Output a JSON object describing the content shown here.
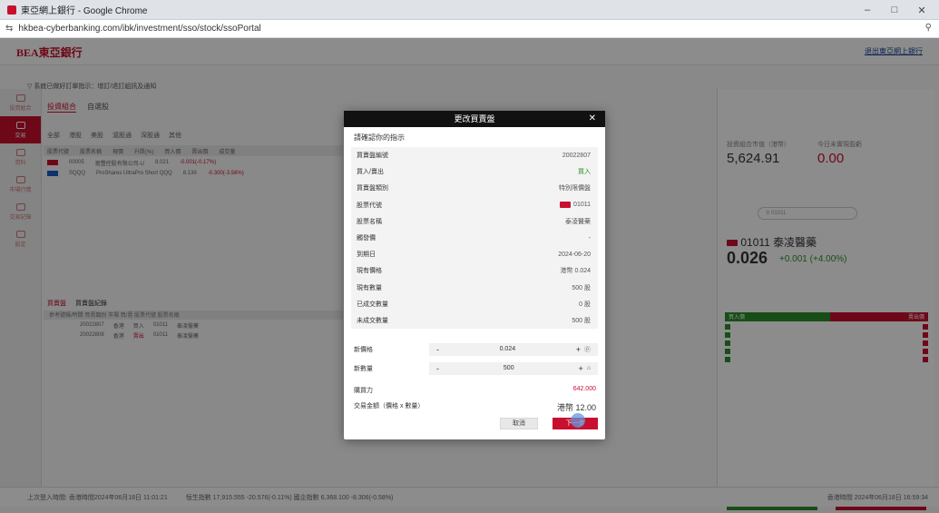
{
  "browser": {
    "window_title": "東亞網上銀行 - Google Chrome",
    "url": "hkbea-cyberbanking.com/ibk/investment/sso/stock/ssoPortal",
    "win_controls": [
      "–",
      "□",
      "✕"
    ],
    "zoom_glyph": "⚲"
  },
  "page": {
    "logo": "BEA東亞銀行",
    "logout": "退出東亞網上銀行",
    "breadcrumb": "▽ 系統已做好訂單指示：增訂/退訂組訊及通知",
    "sidebar_items": [
      "投資組合",
      "交易",
      "資料",
      "市場行情",
      "交易記錄",
      "設定"
    ],
    "tabs_left": [
      "投資組合",
      "自選股"
    ],
    "subtabs": [
      "全部",
      "港股",
      "美股",
      "滬股通",
      "深股通",
      "其他"
    ],
    "grid_headers": [
      "股票代號",
      "股票名稱",
      "現價",
      "升跌(%)",
      "買入價",
      "賣出價",
      "成交量"
    ],
    "grid_rows": [
      [
        "00005",
        "滙豐控股有限公司-U",
        "8.021",
        "-0.001(-0.17%)"
      ],
      [
        "SQQQ",
        "ProShares UltraPro Short QQQ",
        "8.139",
        "-0.300(-3.56%)"
      ]
    ],
    "orders_tabs": [
      "買賣盤",
      "買賣盤紀錄"
    ],
    "orders_head": "參考號碼/時間    買賣類別   市場    買/賣   股票代號   股票名稱",
    "order_rows": [
      [
        "20022807",
        "香港",
        "買入",
        "01011",
        "泰凌醫藥"
      ],
      [
        "20022808",
        "香港",
        "賣出",
        "01011",
        "泰凌醫藥"
      ]
    ],
    "market_value_label": "投資組合市值（港幣）",
    "market_value": "5,624.91",
    "today_pl_label": "今日未實現盈虧",
    "today_pl": "0.00",
    "stock_search": "⚲ 01011",
    "stock_code": "01011",
    "stock_name": "泰凌醫藥",
    "stock_price": "0.026",
    "stock_change": "+0.001 (+4.00%)",
    "book_buy": "買入價",
    "book_sell": "賣出價",
    "buy_label": "買入",
    "sell_label": "賣出",
    "footer_login": "上次登入時間: 香港時間2024年06月18日 11:01:21",
    "footer_index": "恒生指數 17,915.555 -20.576(-0.11%)    國企指數 6,368.100 -8.306(-0.58%)",
    "footer_time": "香港時間 2024年06月18日 16:59:34"
  },
  "modal": {
    "title": "更改買賣盤",
    "close": "✕",
    "subtitle": "請確認你的指示",
    "info_rows": [
      {
        "label": "買賣盤編號",
        "value": "20022807",
        "style": ""
      },
      {
        "label": "買入/賣出",
        "value": "買入",
        "style": "green"
      },
      {
        "label": "買賣盤類別",
        "value": "特別限價盤",
        "style": ""
      },
      {
        "label": "股票代號",
        "value": "01011",
        "style": "flag"
      },
      {
        "label": "股票名稱",
        "value": "泰凌醫藥",
        "style": ""
      },
      {
        "label": "觸發價",
        "value": "-",
        "style": ""
      },
      {
        "label": "到期日",
        "value": "2024-06-20",
        "style": ""
      },
      {
        "label": "現有價格",
        "value": "港幣 0.024",
        "style": ""
      },
      {
        "label": "現有數量",
        "value": "500 股",
        "style": ""
      },
      {
        "label": "已成交數量",
        "value": "0 股",
        "style": ""
      },
      {
        "label": "未成交數量",
        "value": "500 股",
        "style": ""
      }
    ],
    "new_price_label": "新價格",
    "new_price": "0.024",
    "new_qty_label": "新數量",
    "new_qty": "500",
    "minus": "-",
    "plus": "+",
    "price_icon": "ⓟ",
    "qty_icon": "⌂",
    "buying_power_label": "購買力",
    "buying_power": "642.000",
    "txn_label": "交易金額（價格 x 數量）",
    "txn_value": "港幣 12.00",
    "cancel": "取消",
    "next": "下一步"
  }
}
